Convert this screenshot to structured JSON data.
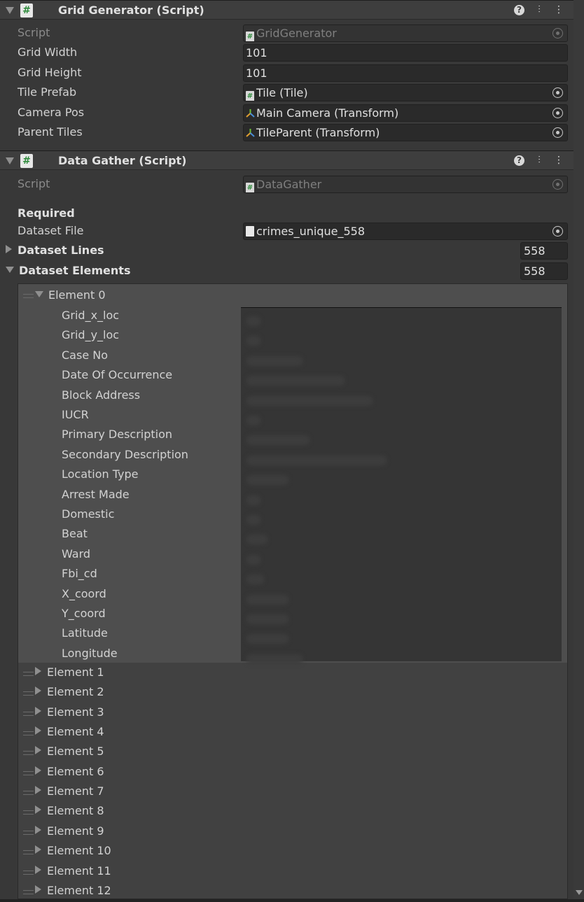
{
  "grid_generator": {
    "title": "Grid Generator (Script)",
    "rows": [
      {
        "label": "Script",
        "value": "GridGenerator",
        "icon": "script-icon",
        "disabled": true
      },
      {
        "label": "Grid Width",
        "value": "101"
      },
      {
        "label": "Grid Height",
        "value": "101"
      },
      {
        "label": "Tile Prefab",
        "value": "Tile (Tile)",
        "icon": "script-icon"
      },
      {
        "label": "Camera Pos",
        "value": "Main Camera (Transform)",
        "icon": "transform-icon"
      },
      {
        "label": "Parent Tiles",
        "value": "TileParent (Transform)",
        "icon": "transform-icon"
      }
    ]
  },
  "data_gather": {
    "title": "Data Gather (Script)",
    "script_label": "Script",
    "script_value": "DataGather",
    "required_header": "Required",
    "dataset_file_label": "Dataset File",
    "dataset_file_value": "crimes_unique_558",
    "dataset_lines_label": "Dataset Lines",
    "dataset_lines_count": "558",
    "dataset_elements_label": "Dataset Elements",
    "dataset_elements_count": "558",
    "element0": {
      "label": "Element 0",
      "fields": [
        "Grid_x_loc",
        "Grid_y_loc",
        "Case No",
        "Date Of Occurrence",
        "Block Address",
        "IUCR",
        "Primary Description",
        "Secondary Description",
        "Location Type",
        "Arrest Made",
        "Domestic",
        "Beat",
        "Ward",
        "Fbi_cd",
        "X_coord",
        "Y_coord",
        "Latitude",
        "Longitude"
      ]
    },
    "collapsed_elements": [
      "Element 1",
      "Element 2",
      "Element 3",
      "Element 4",
      "Element 5",
      "Element 6",
      "Element 7",
      "Element 8",
      "Element 9",
      "Element 10",
      "Element 11",
      "Element 12"
    ]
  },
  "colors": {
    "background": "#383838",
    "header": "#3e3e3e",
    "field": "#2a2a2a",
    "script_icon_green": "#2d8a3a"
  }
}
